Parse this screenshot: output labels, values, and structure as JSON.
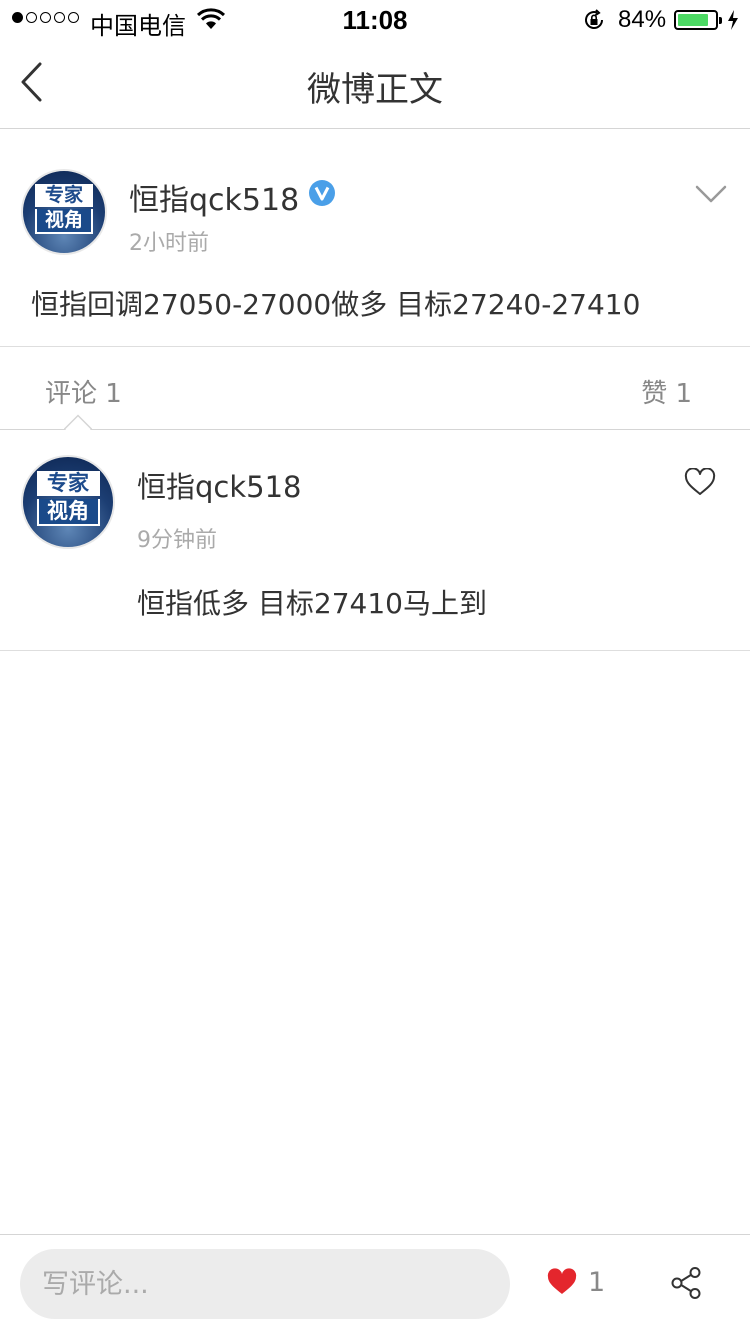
{
  "status_bar": {
    "carrier": "中国电信",
    "time": "11:08",
    "battery_percent": "84%",
    "battery_level": 0.84,
    "signal_bars_filled": 1,
    "signal_bars_total": 5
  },
  "nav": {
    "title": "微博正文",
    "back_icon": "chevron-left-icon"
  },
  "post": {
    "avatar_line1": "专家",
    "avatar_line2": "视角",
    "username": "恒指qck518",
    "verified_icon": "verified-badge-icon",
    "time": "2小时前",
    "text": "恒指回调27050-27000做多 目标27240-27410",
    "more_icon": "chevron-down-icon"
  },
  "tabs": {
    "comments": "评论 1",
    "likes": "赞 1"
  },
  "comments": [
    {
      "avatar_line1": "专家",
      "avatar_line2": "视角",
      "username": "恒指qck518",
      "time": "9分钟前",
      "text": "恒指低多 目标27410马上到",
      "like_icon": "heart-outline-icon"
    }
  ],
  "bottom_bar": {
    "input_placeholder": "写评论...",
    "like_count": "1",
    "like_icon": "heart-filled-icon",
    "share_icon": "share-icon"
  },
  "colors": {
    "like_red": "#e4262d",
    "verified_blue": "#4a9fe8",
    "battery_green": "#4cd964",
    "secondary_text": "#aaaaaa"
  }
}
